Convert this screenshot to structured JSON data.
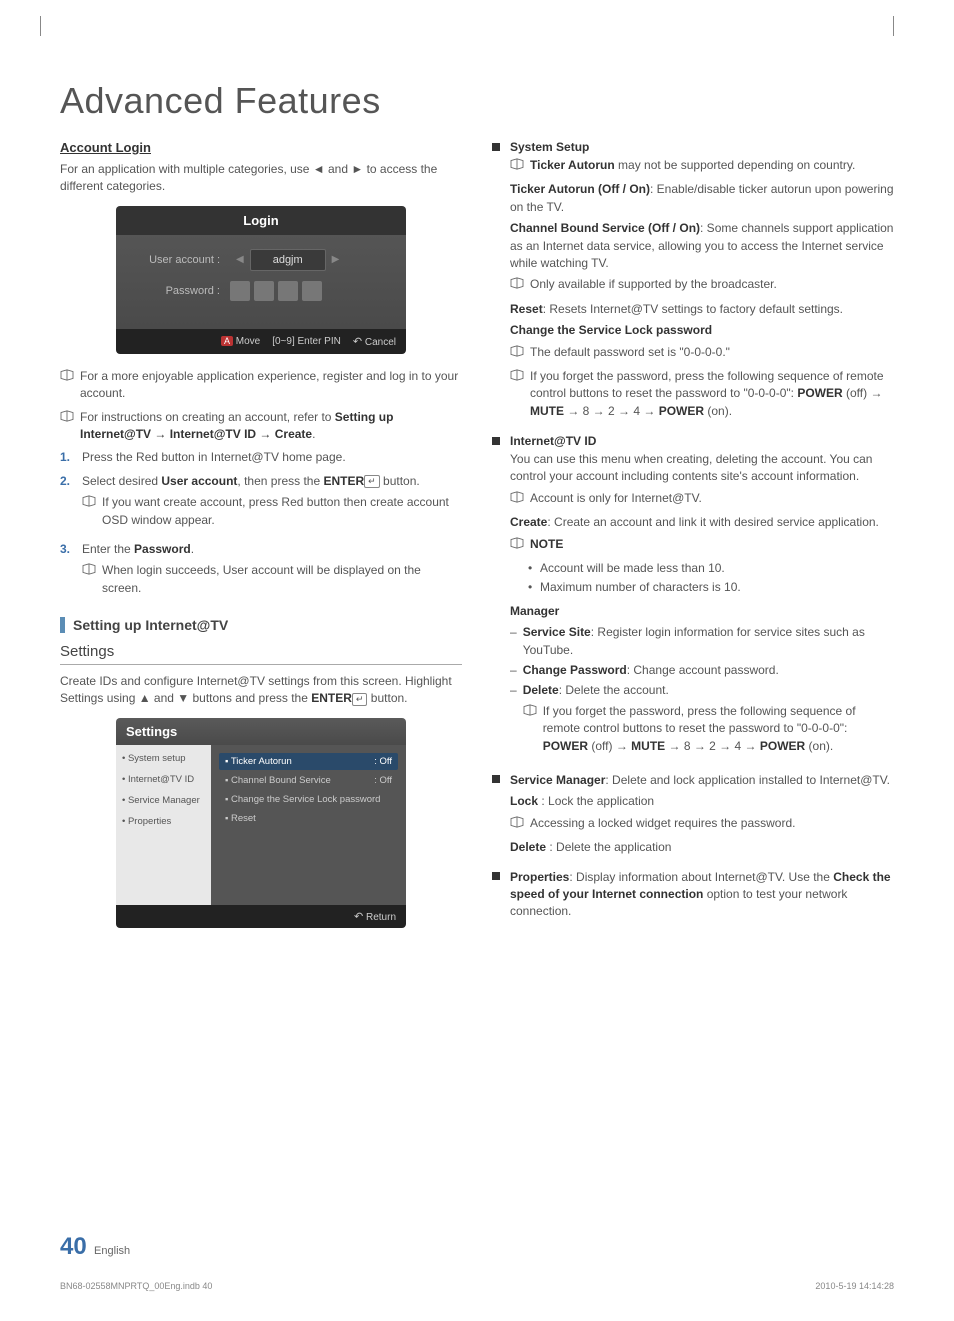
{
  "title": "Advanced Features",
  "left": {
    "accountLoginHeading": "Account Login",
    "accountLoginIntro": "For an application with multiple categories, use ◄ and ► to access the different categories.",
    "loginBox": {
      "header": "Login",
      "userAccountLabel": "User account :",
      "userAccountValue": "adgjm",
      "passwordLabel": "Password :",
      "footerMove": "Move",
      "footerEnterPin": "[0~9] Enter PIN",
      "footerCancel": "Cancel"
    },
    "note1": "For a more enjoyable application experience, register and log in to your account.",
    "note2a": "For instructions on creating an account, refer to ",
    "note2b": "Setting up Internet@TV → Internet@TV ID → Create",
    "note2c": ".",
    "step1": "Press the Red button in Internet@TV home page.",
    "step2a": "Select desired ",
    "step2b": "User account",
    "step2c": ", then press the ",
    "step2d": "ENTER",
    "step2e": " button.",
    "step2note": "If you want create account, press Red button then create account OSD window appear.",
    "step3a": "Enter the ",
    "step3b": "Password",
    "step3c": ".",
    "step3note": "When login succeeds, User account will be displayed on the screen.",
    "settingUpHeading": "Setting up Internet@TV",
    "settingsHeading": "Settings",
    "settingsIntro1": "Create IDs and configure Internet@TV settings from this screen. Highlight Settings using ▲ and ▼ buttons and press the ",
    "settingsIntro2": "ENTER",
    "settingsIntro3": " button.",
    "settingsBox": {
      "header": "Settings",
      "sidebar": [
        "• System setup",
        "• Internet@TV ID",
        "• Service Manager",
        "• Properties"
      ],
      "rows": [
        {
          "label": "▪ Ticker Autorun",
          "value": ": Off"
        },
        {
          "label": "▪ Channel Bound Service",
          "value": ": Off"
        },
        {
          "label": "▪ Change the Service Lock password",
          "value": ""
        },
        {
          "label": "▪ Reset",
          "value": ""
        }
      ],
      "footerReturn": "Return"
    }
  },
  "right": {
    "systemSetup": {
      "heading": "System Setup",
      "note1a": "Ticker Autorun",
      "note1b": " may not be supported depending on country.",
      "tickerAutorun": "Ticker Autorun (Off / On)",
      "tickerAutorunDesc": ": Enable/disable ticker autorun upon powering on the TV.",
      "channelBound": "Channel Bound Service (Off / On)",
      "channelBoundDesc": ": Some channels support application as an Internet data service, allowing you to access the Internet service while watching TV.",
      "channelBoundNote": "Only available if supported by the broadcaster.",
      "reset": "Reset",
      "resetDesc": ": Resets Internet@TV settings to factory default settings.",
      "changeLockHeading": "Change the Service Lock password",
      "lockNote1": "The default password set is \"0-0-0-0.\"",
      "lockNote2a": "If you forget the password, press the following sequence of remote control buttons to reset the password to \"0-0-0-0\": ",
      "lockNote2b": "POWER",
      "lockNote2c": " (off) → ",
      "lockNote2d": "MUTE",
      "lockNote2e": " → 8 → 2 → 4 → ",
      "lockNote2f": "POWER",
      "lockNote2g": " (on)."
    },
    "internetId": {
      "heading": "Internet@TV ID",
      "intro": "You can use this menu when creating, deleting the account. You can control your account including contents site's account information.",
      "accountNote": "Account is only for Internet@TV.",
      "create": "Create",
      "createDesc": ": Create an account and link it with desired service application.",
      "noteLabel": "NOTE",
      "noteItems": [
        "Account will be made less than 10.",
        "Maximum number of characters is 10."
      ],
      "managerHeading": "Manager",
      "serviceSite": "Service Site",
      "serviceSiteDesc": ": Register login information for service sites such as YouTube.",
      "changePassword": "Change Password",
      "changePasswordDesc": ": Change account password.",
      "delete": "Delete",
      "deleteDesc": ": Delete the account.",
      "deleteNote1": "If you forget the password, press the following sequence of remote control buttons to reset the password to \"0-0-0-0\": ",
      "deleteNote2": "POWER",
      "deleteNote3": " (off) → ",
      "deleteNote4": "MUTE",
      "deleteNote5": " → 8 → 2 → 4 → ",
      "deleteNote6": "POWER",
      "deleteNote7": " (on)."
    },
    "serviceManager": {
      "heading": "Service Manager",
      "desc": ": Delete and lock application installed to Internet@TV.",
      "lock": "Lock",
      "lockDesc": " : Lock the application",
      "lockNote": "Accessing a locked widget requires the password.",
      "del": "Delete",
      "delDesc": " : Delete the application"
    },
    "properties": {
      "heading": "Properties",
      "desc1": ": Display information about Internet@TV. Use the ",
      "desc2": "Check the speed of your Internet connection",
      "desc3": " option to test your network connection."
    }
  },
  "footer": {
    "pageNum": "40",
    "lang": "English",
    "printFile": "BN68-02558MNPRTQ_00Eng.indb   40",
    "printDate": "2010-5-19   14:14:28"
  }
}
